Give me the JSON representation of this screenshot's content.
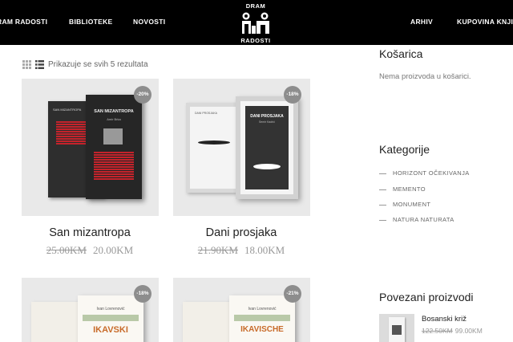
{
  "header": {
    "nav_left": [
      "RAM RADOSTI",
      "BIBLIOTEKE",
      "NOVOSTI"
    ],
    "nav_right": [
      "ARHIV",
      "KUPOVINA KNJIG"
    ],
    "logo_top": "DRAM",
    "logo_bottom": "RADOSTI"
  },
  "toolbar": {
    "result_text": "Prikazuje se svih 5 rezultata"
  },
  "products": [
    {
      "title": "San mizantropa",
      "badge": "-20%",
      "old_price": "25.00KM",
      "new_price": "20.00KM",
      "cover_title": "SAN MIZANTROPA",
      "cover_author": "Amir Brka"
    },
    {
      "title": "Dani prosjaka",
      "badge": "-18%",
      "old_price": "21.90KM",
      "new_price": "18.00KM",
      "cover_title": "DANI PROSJAKA",
      "cover_author": "Semir Kadrić"
    },
    {
      "title": "",
      "badge": "-18%",
      "cover_author": "Ivan Lovrenović",
      "cover_title": "IKAVSKI"
    },
    {
      "title": "",
      "badge": "-21%",
      "cover_author": "Ivan Lovrenović",
      "cover_title": "IKAVISCHE"
    }
  ],
  "sidebar": {
    "cart_title": "Košarica",
    "cart_empty": "Nema proizvoda u košarici.",
    "categories_title": "Kategorije",
    "categories": [
      "HORIZONT OČEKIVANJA",
      "MEMENTO",
      "MONUMENT",
      "NATURA NATURATA"
    ],
    "related_title": "Povezani proizvodi",
    "related": {
      "title": "Bosanski križ",
      "old_price": "122.50KM",
      "new_price": "99.00KM"
    }
  },
  "colors": {
    "header_bg": "#000000",
    "badge_bg": "#8d8d8d",
    "card_bg": "#e9e9e9",
    "book_dark": "#2b2b2b",
    "book_red": "#c4232b"
  }
}
